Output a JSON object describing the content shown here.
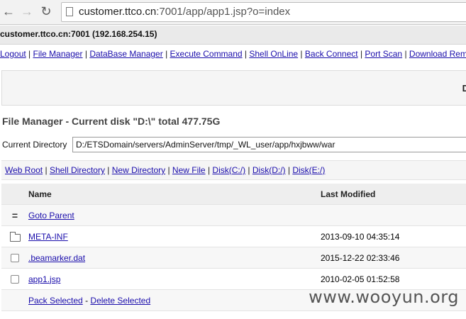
{
  "browser": {
    "url_host": "customer.ttco.cn",
    "url_rest": ":7001/app/app1.jsp?o=index"
  },
  "page": {
    "host_line": "customer.ttco.cn:7001 (192.168.254.15)",
    "menu": [
      "Logout",
      "File Manager",
      "DataBase Manager",
      "Execute Command",
      "Shell OnLine",
      "Back Connect",
      "Port Scan",
      "Download Remo"
    ],
    "banner_text": "D",
    "fm_title": "File Manager - Current disk \"D:\\\" total 477.75G",
    "current_dir_label": "Current Directory",
    "current_dir_value": "D:/ETSDomain/servers/AdminServer/tmp/_WL_user/app/hxjbww/war",
    "quick_links": [
      "Web Root",
      "Shell Directory",
      "New Directory",
      "New File",
      "Disk(C:/)",
      "Disk(D:/)",
      "Disk(E:/)"
    ],
    "table": {
      "headers": {
        "name": "Name",
        "modified": "Last Modified"
      },
      "parent_label": "Goto Parent",
      "rows": [
        {
          "name": "META-INF",
          "modified": "2013-09-10 04:35:14",
          "icon": "folder-icon"
        },
        {
          "name": ".beamarker.dat",
          "modified": "2015-12-22 02:33:46",
          "icon": "checkbox"
        },
        {
          "name": "app1.jsp",
          "modified": "2010-02-05 01:52:58",
          "icon": "checkbox"
        }
      ],
      "actions": {
        "pack": "Pack Selected",
        "separator": "-",
        "delete": "Delete Selected"
      }
    },
    "watermark": "www.wooyun.org"
  }
}
